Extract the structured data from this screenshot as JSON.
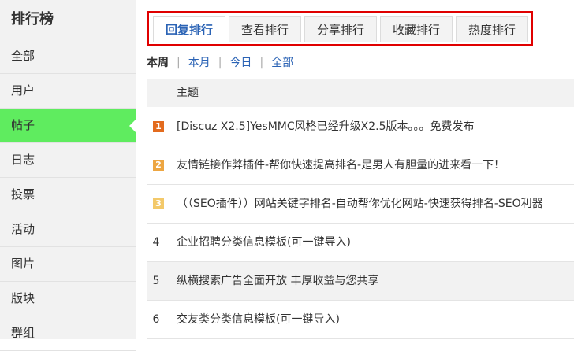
{
  "sidebar": {
    "title": "排行榜",
    "items": [
      {
        "label": "全部"
      },
      {
        "label": "用户"
      },
      {
        "label": "帖子"
      },
      {
        "label": "日志"
      },
      {
        "label": "投票"
      },
      {
        "label": "活动"
      },
      {
        "label": "图片"
      },
      {
        "label": "版块"
      },
      {
        "label": "群组"
      }
    ],
    "active_item": "帖子",
    "active_color": "#5fec5f"
  },
  "tabs": [
    {
      "label": "回复排行"
    },
    {
      "label": "查看排行"
    },
    {
      "label": "分享排行"
    },
    {
      "label": "收藏排行"
    },
    {
      "label": "热度排行"
    }
  ],
  "active_tab": "回复排行",
  "periods": [
    {
      "label": "本周"
    },
    {
      "label": "本月"
    },
    {
      "label": "今日"
    },
    {
      "label": "全部"
    }
  ],
  "active_period": "本周",
  "table": {
    "header": "主题",
    "rows": [
      {
        "rank": "1",
        "title": "[Discuz X2.5]YesMMC风格已经升级X2.5版本。。。免费发布",
        "badge_color": "#e36b1e"
      },
      {
        "rank": "2",
        "title": "友情链接作弊插件-帮你快速提高排名-是男人有胆量的进来看一下！",
        "badge_color": "#eda642"
      },
      {
        "rank": "3",
        "title": "（（SEO插件））网站关键字排名-自动帮你优化网站-快速获得排名-SEO利器",
        "badge_color": "#f3c96a"
      },
      {
        "rank": "4",
        "title": "企业招聘分类信息模板(可一键导入)"
      },
      {
        "rank": "5",
        "title": "纵横搜索广告全面开放 丰厚收益与您共享"
      },
      {
        "rank": "6",
        "title": "交友类分类信息模板(可一键导入)"
      }
    ]
  },
  "colors": {
    "highlight_border": "#e00000",
    "link": "#2b63b5"
  }
}
